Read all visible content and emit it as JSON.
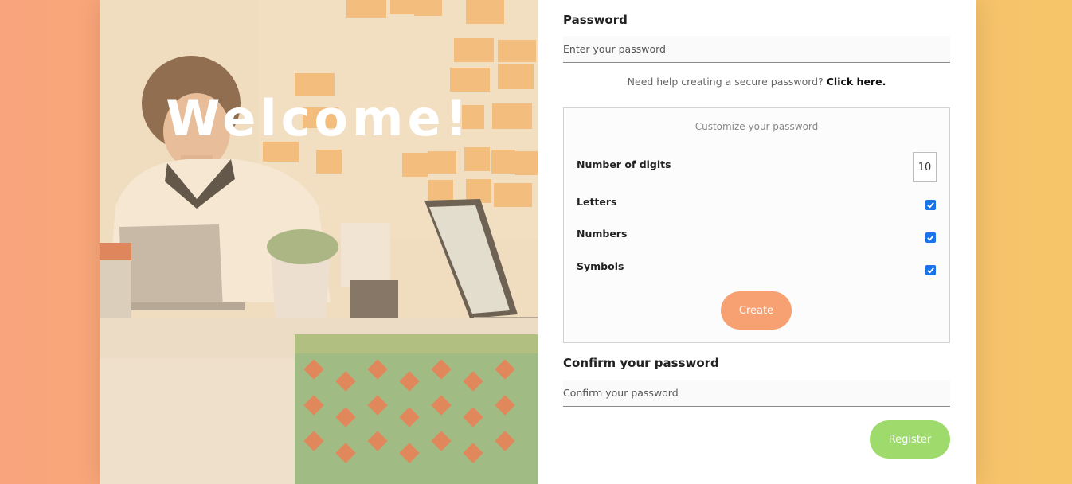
{
  "hero": {
    "title": "Welcome!",
    "image": "man-working-at-laptop-in-office"
  },
  "form": {
    "password_label": "Password",
    "password_placeholder": "Enter your password",
    "help_text": "Need help creating a secure password?",
    "help_link": "Click here.",
    "customize": {
      "title": "Customize your password",
      "digits_label": "Number of digits",
      "digits_value": "10",
      "letters_label": "Letters",
      "letters_checked": true,
      "numbers_label": "Numbers",
      "numbers_checked": true,
      "symbols_label": "Symbols",
      "symbols_checked": true,
      "create_label": "Create"
    },
    "confirm_label": "Confirm your password",
    "confirm_placeholder": "Confirm your password",
    "register_label": "Register"
  },
  "colors": {
    "create_button": "#f7a072",
    "register_button": "#9fdb6c",
    "checkbox": "#1a73e8"
  }
}
